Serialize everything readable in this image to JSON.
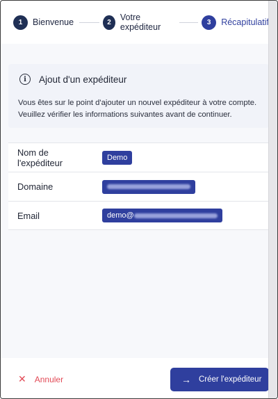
{
  "stepper": {
    "steps": [
      {
        "number": "1",
        "label": "Bienvenue"
      },
      {
        "number": "2",
        "label": "Votre expéditeur"
      },
      {
        "number": "3",
        "label": "Récapitulatif"
      }
    ],
    "active_step": "3"
  },
  "info": {
    "icon": "info-circle-icon",
    "title": "Ajout d'un expéditeur",
    "text": "Vous êtes sur le point d'ajouter un nouvel expéditeur à votre compte. Veuillez vérifier les informations suivantes avant de continuer."
  },
  "details": {
    "rows": [
      {
        "label": "Nom de l'expéditeur",
        "value": "Demo"
      },
      {
        "label": "Domaine",
        "value": ""
      },
      {
        "label": "Email",
        "value": "demo@"
      }
    ]
  },
  "footer": {
    "cancel_label": "Annuler",
    "create_label": "Créer l'expéditeur"
  },
  "colors": {
    "primary": "#2f3f9e",
    "danger": "#e24a56",
    "step_dark": "#1f2f55"
  }
}
